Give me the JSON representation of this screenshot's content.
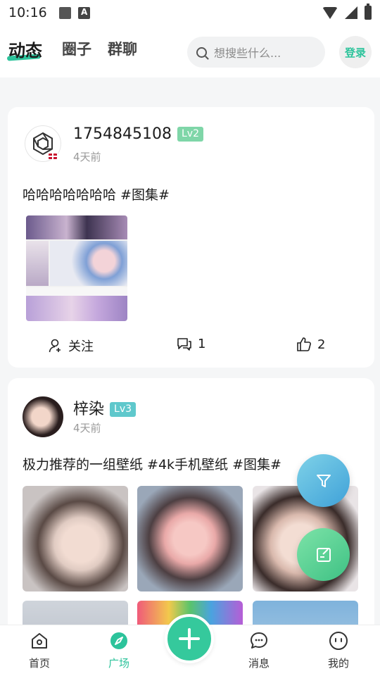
{
  "status_bar": {
    "time": "10:16"
  },
  "header": {
    "tabs": [
      {
        "label": "动态",
        "active": true
      },
      {
        "label": "圈子",
        "active": false
      },
      {
        "label": "群聊",
        "active": false
      }
    ],
    "search_placeholder": "想搜些什么...",
    "login_label": "登录"
  },
  "posts": [
    {
      "username": "1754845108",
      "level": "Lv2",
      "time": "4天前",
      "text": "哈哈哈哈哈哈哈 #图集#",
      "actions": {
        "follow_label": "关注",
        "comment_count": "1",
        "like_count": "2"
      }
    },
    {
      "username": "梓染",
      "level": "Lv3",
      "time": "4天前",
      "text": "极力推荐的一组壁纸 #4k手机壁纸 #图集#"
    }
  ],
  "bottom_nav": {
    "items": [
      {
        "label": "首页",
        "icon": "home-icon"
      },
      {
        "label": "广场",
        "icon": "compass-icon",
        "active": true
      },
      {
        "label": "消息",
        "icon": "chat-icon"
      },
      {
        "label": "我的",
        "icon": "profile-face-icon"
      }
    ],
    "add_icon": "plus-icon"
  },
  "colors": {
    "accent": "#2cc39b",
    "lv2": "#7fd6a8",
    "lv3": "#5fc8cc"
  }
}
